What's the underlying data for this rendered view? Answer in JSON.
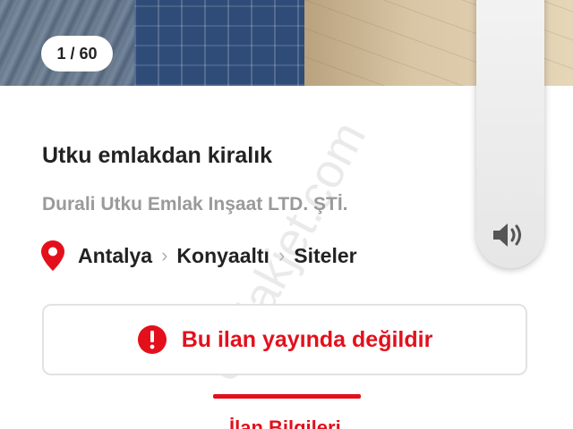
{
  "gallery": {
    "counter": "1 / 60"
  },
  "listing": {
    "title": "Utku emlakdan kiralık",
    "company": "Durali Utku Emlak Inşaat LTD. ŞTİ.",
    "location": {
      "city": "Antalya",
      "district": "Konyaaltı",
      "neighborhood": "Siteler"
    }
  },
  "notice": {
    "text": "Bu ilan yayında değildir"
  },
  "tabs": {
    "active_label": "İlan Bilgileri"
  },
  "watermark": "emlakjet.com",
  "colors": {
    "accent": "#e3101c",
    "text": "#222222",
    "muted": "#9a9a9a"
  },
  "icons": {
    "location": "map-pin-icon",
    "notice": "alert-icon",
    "volume": "speaker-volume-icon"
  }
}
